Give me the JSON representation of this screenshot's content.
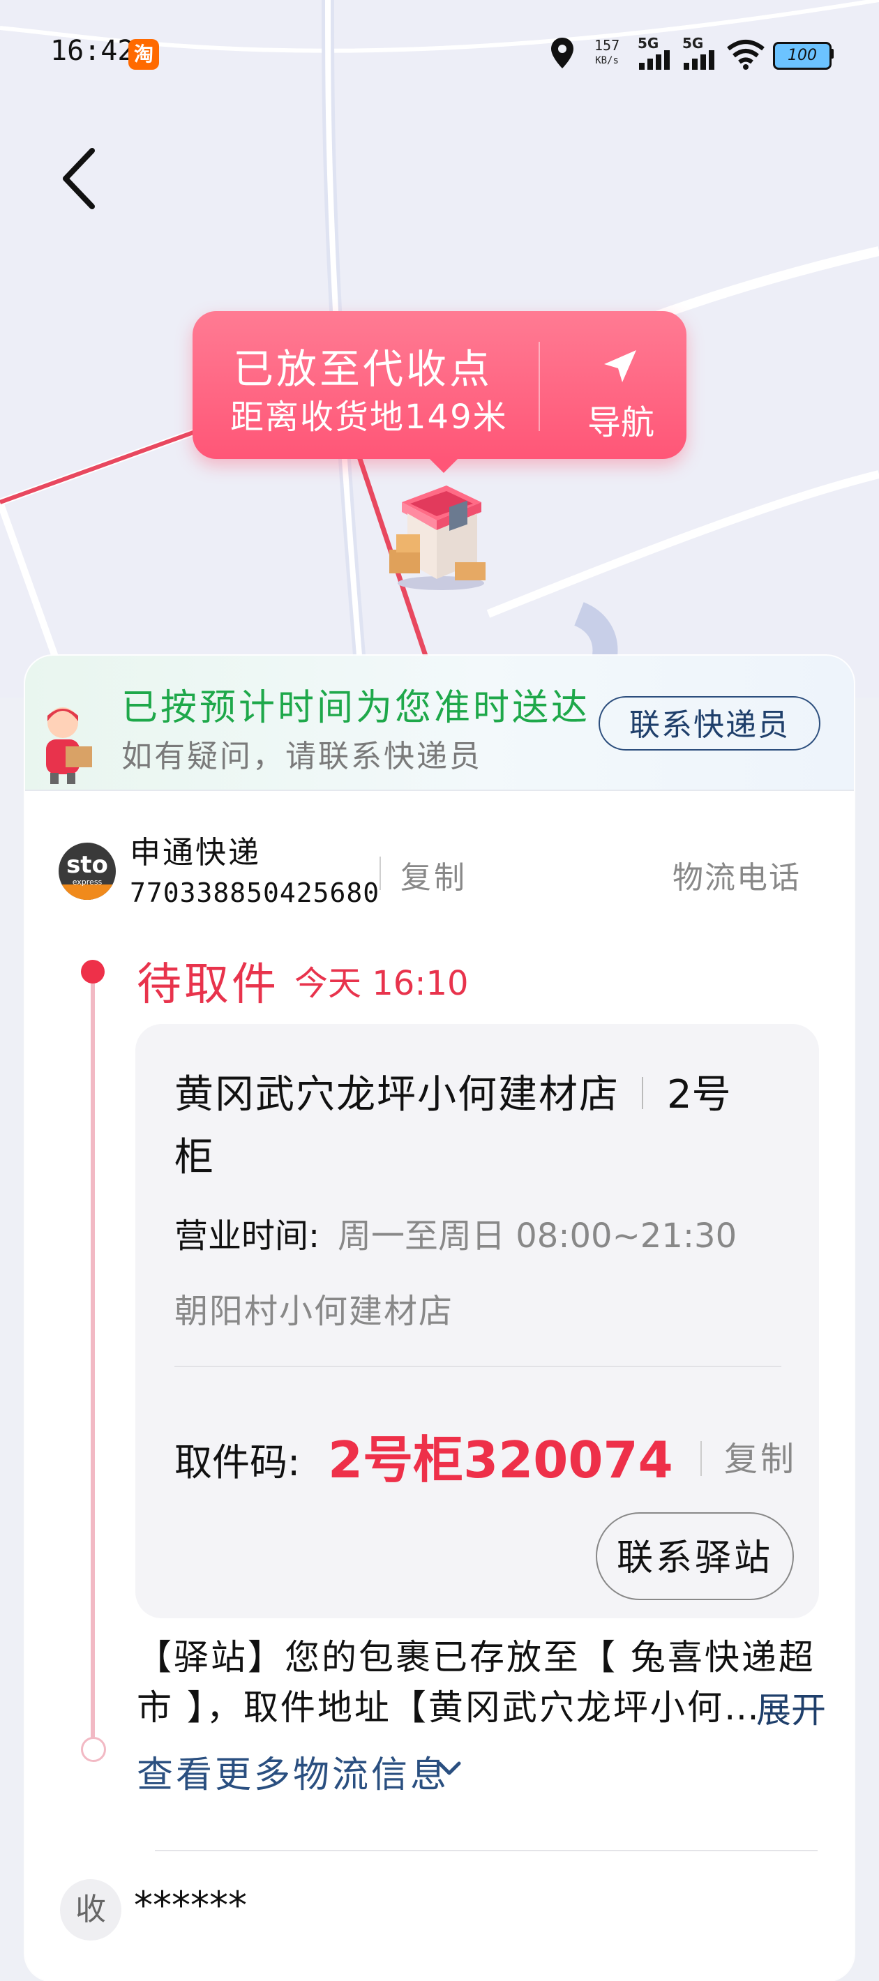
{
  "status_bar": {
    "time": "16:42",
    "app_badge": "淘",
    "network_speed_value": "157",
    "network_speed_unit": "KB/s",
    "signal1_label": "5G",
    "signal2_label": "5G",
    "battery": "100",
    "icons": [
      "location-icon",
      "signal-icon",
      "signal-icon",
      "wifi-icon",
      "battery-icon"
    ]
  },
  "map": {
    "callout": {
      "title": "已放至代收点",
      "distance": "距离收货地149米",
      "nav_label": "导航"
    }
  },
  "banner": {
    "title": "已按预计时间为您准时送达",
    "subtitle": "如有疑问，请联系快递员",
    "contact_courier": "联系快递员"
  },
  "carrier": {
    "logo_text": "sto",
    "logo_sub": "express",
    "name": "申通快递",
    "tracking_number": "770338850425680",
    "copy_label": "复制",
    "phone_label": "物流电话"
  },
  "timeline": {
    "status": "待取件",
    "time": "今天 16:10",
    "station": {
      "name_line1": "黄冈武穴龙坪小何建材店",
      "cabinet": "2号",
      "name_line2": "柜",
      "hours_label": "营业时间:",
      "hours_value": "周一至周日 08:00~21:30",
      "address": "朝阳村小何建材店",
      "code_label": "取件码:",
      "code_value": "2号柜320074",
      "copy_label": "复制",
      "contact_station": "联系驿站"
    },
    "log_line1": "【驿站】您的包裹已存放至【 兔喜快递超",
    "log_line2": "市 】，取件地址【黄冈武穴龙坪小何…",
    "expand_label": "展开",
    "more_label": "查看更多物流信息"
  },
  "receiver": {
    "badge": "收",
    "name": "******"
  },
  "colors": {
    "accent_red": "#ee3049",
    "callout_pink": "#ff5677",
    "success_green": "#1ea84a",
    "link_blue": "#2a4f80"
  }
}
